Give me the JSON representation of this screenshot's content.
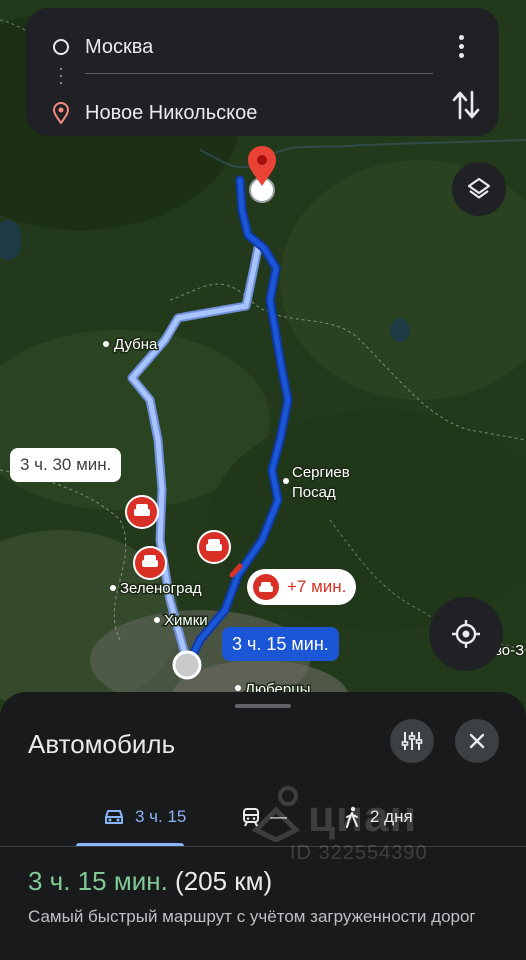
{
  "route": {
    "from": "Москва",
    "to": "Новое Никольское"
  },
  "map": {
    "labels": {
      "dubna": "Дубна",
      "sergiev_1": "Сергиев",
      "sergiev_2": "Посад",
      "zelenograd": "Зеленоград",
      "khimki": "Химки",
      "lyubertsy": "Люберцы",
      "edge": "во-З"
    },
    "alt_route_time": "3 ч. 30 мин.",
    "main_route_time": "3 ч. 15 мин.",
    "delay": "+7 мин."
  },
  "sheet": {
    "title": "Автомобиль",
    "tabs": [
      {
        "icon": "car-icon",
        "label": "3 ч. 15"
      },
      {
        "icon": "train-icon",
        "label": "—"
      },
      {
        "icon": "walk-icon",
        "label": "2 дня"
      }
    ],
    "summary_time": "3 ч. 15 мин.",
    "summary_distance": "(205 км)",
    "description": "Самый быстрый маршрут с учётом загруженности дорог"
  },
  "watermark": {
    "brand": "циан",
    "id": "ID 322554390"
  },
  "colors": {
    "main_route": "#1a56d6",
    "alt_route": "#a8c4ff",
    "accent_green": "#81c995",
    "accent_blue": "#8ab4f8",
    "traffic_red": "#d93025"
  }
}
